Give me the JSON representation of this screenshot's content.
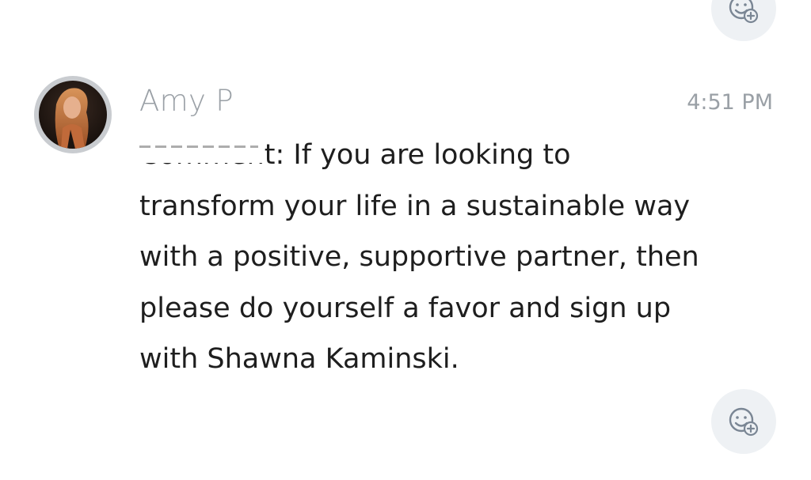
{
  "message": {
    "author": "Amy P",
    "time": "4:51 PM",
    "body_lines": [
      "Comment: If you are looking to",
      "transform your life in a sustainable way",
      "with a positive, supportive partner, then",
      "please do yourself a favor and sign up",
      "with Shawna Kaminski."
    ]
  },
  "icons": {
    "reaction": "add-reaction-icon"
  },
  "colors": {
    "secondary_text": "#9aa0a6",
    "body_text": "#1e1e1e",
    "reaction_bg": "#eef1f4",
    "icon_stroke": "#7a8694"
  }
}
